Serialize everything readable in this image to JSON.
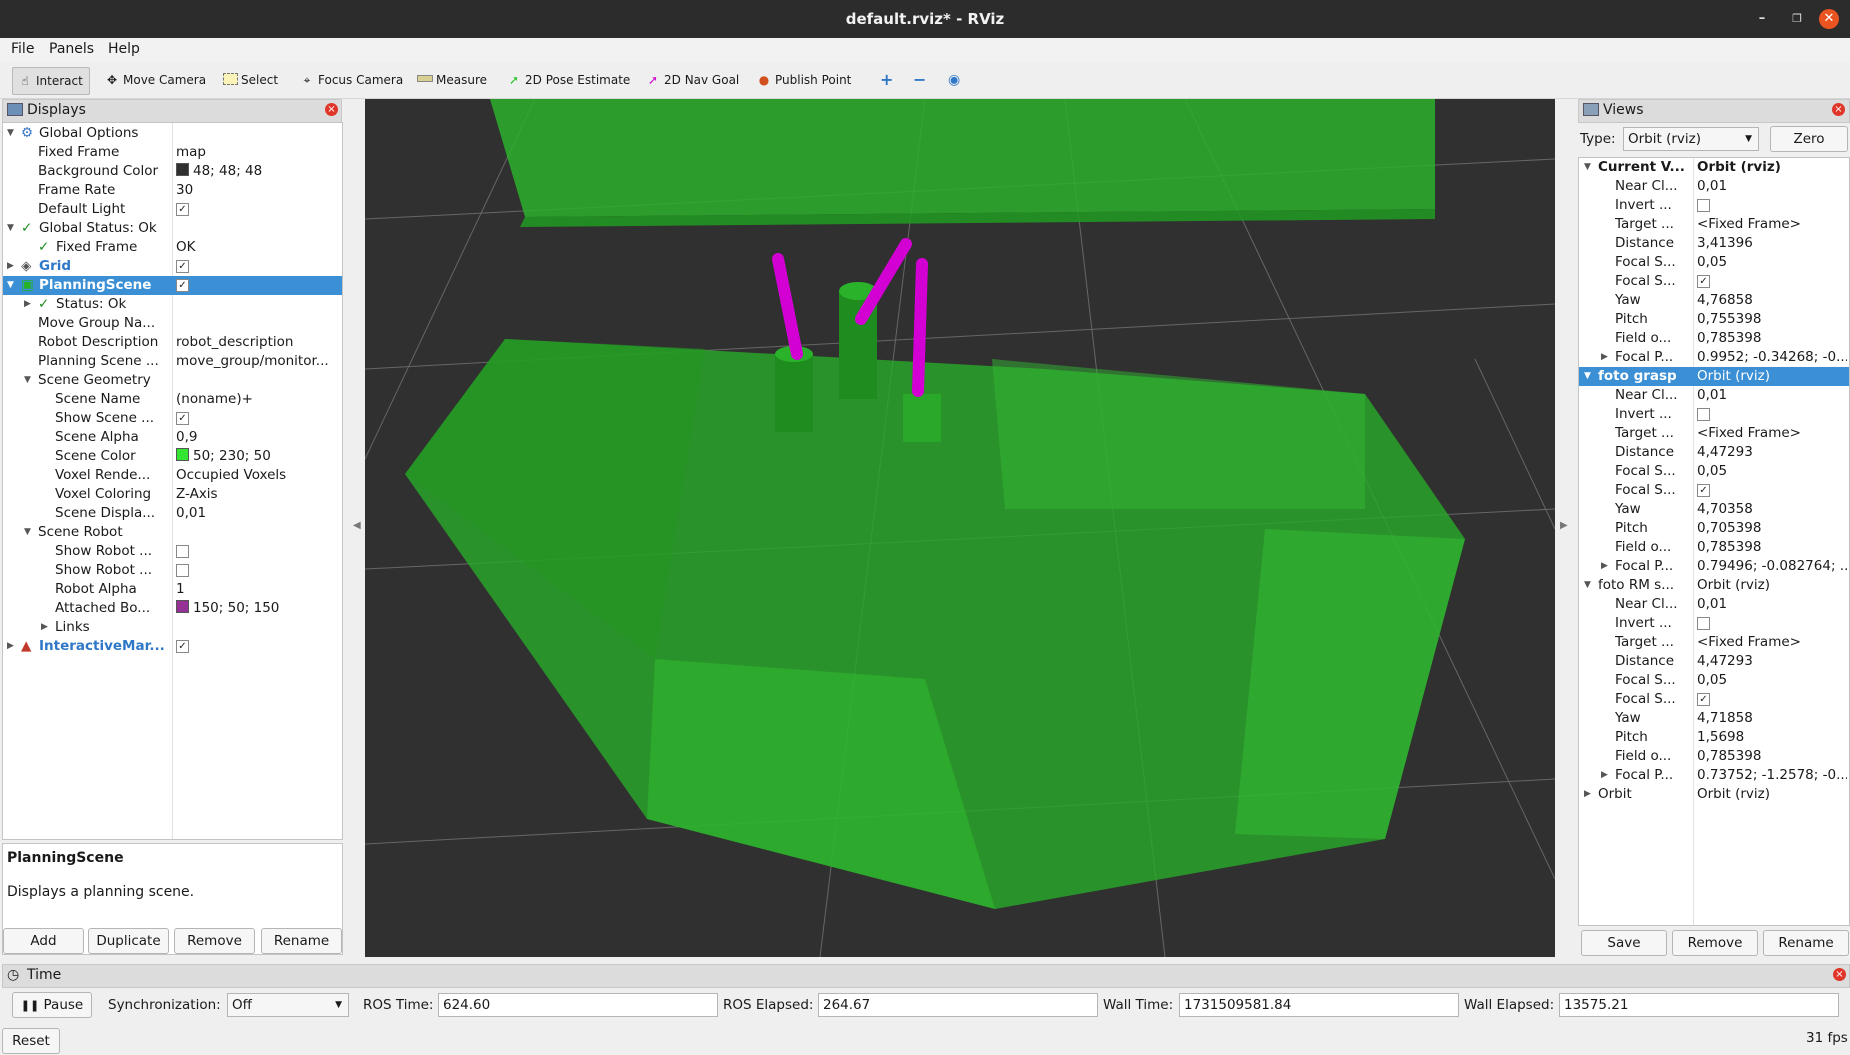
{
  "window": {
    "title": "default.rviz* - RViz"
  },
  "menu": [
    "File",
    "Panels",
    "Help"
  ],
  "toolbar": {
    "tools": [
      {
        "label": "Interact",
        "icon": "hand-icon"
      },
      {
        "label": "Move Camera",
        "icon": "move-camera-icon"
      },
      {
        "label": "Select",
        "icon": "select-icon"
      },
      {
        "label": "Focus Camera",
        "icon": "focus-camera-icon"
      },
      {
        "label": "Measure",
        "icon": "measure-icon"
      },
      {
        "label": "2D Pose Estimate",
        "icon": "pose-estimate-arrow-icon"
      },
      {
        "label": "2D Nav Goal",
        "icon": "nav-goal-arrow-icon"
      },
      {
        "label": "Publish Point",
        "icon": "publish-point-pin-icon"
      }
    ]
  },
  "displays": {
    "title": "Displays",
    "rows": [
      {
        "indent": 0,
        "arrow": "down",
        "icon": "gear",
        "key": "Global Options",
        "value": ""
      },
      {
        "indent": 1,
        "arrow": "",
        "key": "Fixed Frame",
        "value": "map"
      },
      {
        "indent": 1,
        "arrow": "",
        "key": "Background Color",
        "value": "48; 48; 48",
        "swatch": "#303030"
      },
      {
        "indent": 1,
        "arrow": "",
        "key": "Frame Rate",
        "value": "30"
      },
      {
        "indent": 1,
        "arrow": "",
        "key": "Default Light",
        "check": true
      },
      {
        "indent": 0,
        "arrow": "down",
        "icon": "check",
        "key": "Global Status: Ok",
        "value": ""
      },
      {
        "indent": 1,
        "arrow": "",
        "icon": "check",
        "key": "Fixed Frame",
        "value": "OK"
      },
      {
        "indent": 0,
        "arrow": "right",
        "icon": "grid",
        "key": "Grid",
        "check": true,
        "blue": true
      },
      {
        "indent": 0,
        "arrow": "down",
        "icon": "planning",
        "key": "PlanningScene",
        "check": true,
        "blue": true,
        "selected": true
      },
      {
        "indent": 1,
        "arrow": "right",
        "icon": "check",
        "key": "Status: Ok",
        "value": ""
      },
      {
        "indent": 1,
        "arrow": "",
        "key": "Move Group Na...",
        "value": ""
      },
      {
        "indent": 1,
        "arrow": "",
        "key": "Robot Description",
        "value": "robot_description"
      },
      {
        "indent": 1,
        "arrow": "",
        "key": "Planning Scene ...",
        "value": "move_group/monitor..."
      },
      {
        "indent": 1,
        "arrow": "down",
        "key": "Scene Geometry",
        "value": ""
      },
      {
        "indent": 2,
        "arrow": "",
        "key": "Scene Name",
        "value": "(noname)+"
      },
      {
        "indent": 2,
        "arrow": "",
        "key": "Show Scene ...",
        "check": true
      },
      {
        "indent": 2,
        "arrow": "",
        "key": "Scene Alpha",
        "value": "0,9"
      },
      {
        "indent": 2,
        "arrow": "",
        "key": "Scene Color",
        "value": "50; 230; 50",
        "swatch": "#32e632"
      },
      {
        "indent": 2,
        "arrow": "",
        "key": "Voxel Rende...",
        "value": "Occupied Voxels"
      },
      {
        "indent": 2,
        "arrow": "",
        "key": "Voxel Coloring",
        "value": "Z-Axis"
      },
      {
        "indent": 2,
        "arrow": "",
        "key": "Scene Displa...",
        "value": "0,01"
      },
      {
        "indent": 1,
        "arrow": "down",
        "key": "Scene Robot",
        "value": ""
      },
      {
        "indent": 2,
        "arrow": "",
        "key": "Show Robot ...",
        "check": false
      },
      {
        "indent": 2,
        "arrow": "",
        "key": "Show Robot ...",
        "check": false
      },
      {
        "indent": 2,
        "arrow": "",
        "key": "Robot Alpha",
        "value": "1"
      },
      {
        "indent": 2,
        "arrow": "",
        "key": "Attached Bo...",
        "value": "150; 50; 150",
        "swatch": "#963296"
      },
      {
        "indent": 2,
        "arrow": "right",
        "key": "Links",
        "value": ""
      },
      {
        "indent": 0,
        "arrow": "right",
        "icon": "interactive",
        "key": "InteractiveMar...",
        "check": true,
        "blue": true
      }
    ],
    "desc_title": "PlanningScene",
    "desc_text": "Displays a planning scene.",
    "buttons": [
      "Add",
      "Duplicate",
      "Remove",
      "Rename"
    ]
  },
  "views": {
    "title": "Views",
    "type_label": "Type:",
    "type_value": "Orbit (rviz)",
    "zero_label": "Zero",
    "rows": [
      {
        "indent": 0,
        "arrow": "down",
        "key": "Current V...",
        "value": "Orbit (rviz)",
        "bold": true
      },
      {
        "indent": 1,
        "key": "Near Cl...",
        "value": "0,01"
      },
      {
        "indent": 1,
        "key": "Invert ...",
        "check": false
      },
      {
        "indent": 1,
        "key": "Target ...",
        "value": "<Fixed Frame>"
      },
      {
        "indent": 1,
        "key": "Distance",
        "value": "3,41396"
      },
      {
        "indent": 1,
        "key": "Focal S...",
        "value": "0,05"
      },
      {
        "indent": 1,
        "key": "Focal S...",
        "check": true
      },
      {
        "indent": 1,
        "key": "Yaw",
        "value": "4,76858"
      },
      {
        "indent": 1,
        "key": "Pitch",
        "value": "0,755398"
      },
      {
        "indent": 1,
        "key": "Field o...",
        "value": "0,785398"
      },
      {
        "indent": 1,
        "arrow": "right",
        "key": "Focal P...",
        "value": "0.9952; -0.34268; -0..."
      },
      {
        "indent": 0,
        "arrow": "down",
        "key": "foto grasp",
        "value": "Orbit (rviz)",
        "selected": true
      },
      {
        "indent": 1,
        "key": "Near Cl...",
        "value": "0,01"
      },
      {
        "indent": 1,
        "key": "Invert ...",
        "check": false
      },
      {
        "indent": 1,
        "key": "Target ...",
        "value": "<Fixed Frame>"
      },
      {
        "indent": 1,
        "key": "Distance",
        "value": "4,47293"
      },
      {
        "indent": 1,
        "key": "Focal S...",
        "value": "0,05"
      },
      {
        "indent": 1,
        "key": "Focal S...",
        "check": true
      },
      {
        "indent": 1,
        "key": "Yaw",
        "value": "4,70358"
      },
      {
        "indent": 1,
        "key": "Pitch",
        "value": "0,705398"
      },
      {
        "indent": 1,
        "key": "Field o...",
        "value": "0,785398"
      },
      {
        "indent": 1,
        "arrow": "right",
        "key": "Focal P...",
        "value": "0.79496; -0.082764; ..."
      },
      {
        "indent": 0,
        "arrow": "down",
        "key": "foto RM s...",
        "value": "Orbit (rviz)"
      },
      {
        "indent": 1,
        "key": "Near Cl...",
        "value": "0,01"
      },
      {
        "indent": 1,
        "key": "Invert ...",
        "check": false
      },
      {
        "indent": 1,
        "key": "Target ...",
        "value": "<Fixed Frame>"
      },
      {
        "indent": 1,
        "key": "Distance",
        "value": "4,47293"
      },
      {
        "indent": 1,
        "key": "Focal S...",
        "value": "0,05"
      },
      {
        "indent": 1,
        "key": "Focal S...",
        "check": true
      },
      {
        "indent": 1,
        "key": "Yaw",
        "value": "4,71858"
      },
      {
        "indent": 1,
        "key": "Pitch",
        "value": "1,5698"
      },
      {
        "indent": 1,
        "key": "Field o...",
        "value": "0,785398"
      },
      {
        "indent": 1,
        "arrow": "right",
        "key": "Focal P...",
        "value": "0.73752; -1.2578; -0...."
      },
      {
        "indent": 0,
        "arrow": "right",
        "key": "Orbit",
        "value": "Orbit (rviz)"
      }
    ],
    "buttons": [
      "Save",
      "Remove",
      "Rename"
    ]
  },
  "time": {
    "title": "Time",
    "pause_label": "Pause",
    "sync_label": "Synchronization:",
    "sync_value": "Off",
    "ros_time_label": "ROS Time:",
    "ros_time": "624.60",
    "ros_elapsed_label": "ROS Elapsed:",
    "ros_elapsed": "264.67",
    "wall_time_label": "Wall Time:",
    "wall_time": "1731509581.84",
    "wall_elapsed_label": "Wall Elapsed:",
    "wall_elapsed": "13575.21",
    "reset_label": "Reset",
    "fps": "31 fps"
  },
  "colors": {
    "viewport_bg": "#303030",
    "scene_green": "#32e632",
    "attached_magenta": "#d200d2",
    "selection": "#3a8fd5"
  }
}
